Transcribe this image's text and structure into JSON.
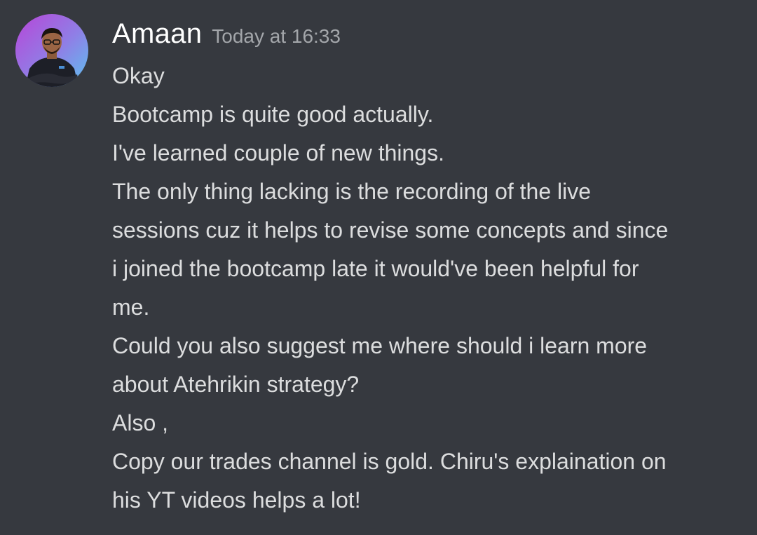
{
  "author": {
    "name": "Amaan",
    "timestamp": "Today at 16:33"
  },
  "message": {
    "lines": [
      "Okay",
      "Bootcamp is quite good actually.",
      "I've learned couple of new things.",
      "The only thing lacking is the recording of the live",
      "sessions cuz it helps to revise some concepts and since",
      "i joined the bootcamp late it would've been helpful for",
      "me.",
      "Could you also suggest me where should i learn more",
      "about Atehrikin strategy?",
      "Also ,",
      "Copy our trades channel is gold. Chiru's explaination on",
      "his YT videos helps a lot!"
    ]
  },
  "colors": {
    "background": "#36393f",
    "username": "#ffffff",
    "timestamp": "#a3a6aa",
    "text": "#dcddde",
    "avatar_ring_start": "#c04bd6",
    "avatar_ring_end": "#5fb0ee"
  }
}
